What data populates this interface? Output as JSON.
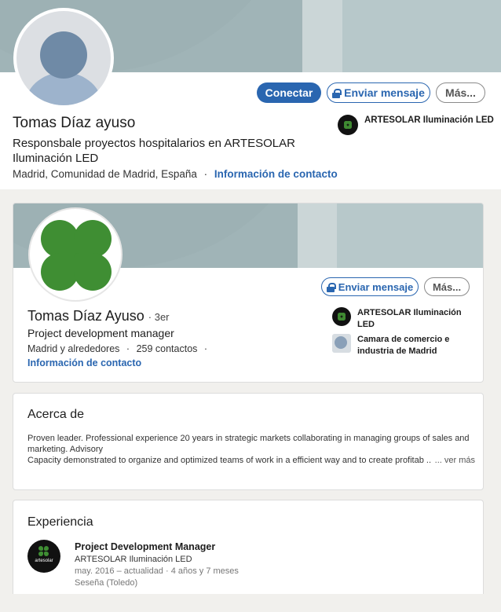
{
  "top_profile": {
    "name": "Tomas Díaz ayuso",
    "headline": "Responsbale proyectos hospitalarios en ARTESOLAR Iluminación LED",
    "location": "Madrid, Comunidad de Madrid, España",
    "separator": "·",
    "contact_link": "Información de contacto",
    "buttons": {
      "connect": "Conectar",
      "message": "Enviar mensaje",
      "more": "Más..."
    },
    "company": "ARTESOLAR Iluminación LED"
  },
  "company_profile": {
    "name": "Tomas Díaz Ayuso",
    "degree": "3er",
    "headline": "Project development manager",
    "location": "Madrid y alrededores",
    "contacts": "259 contactos",
    "contact_link": "Información de contacto",
    "buttons": {
      "message": "Enviar mensaje",
      "more": "Más..."
    },
    "companies": [
      {
        "name": "ARTESOLAR Iluminación LED"
      },
      {
        "name": "Camara de comercio e industria de Madrid"
      }
    ]
  },
  "about": {
    "title": "Acerca de",
    "line1": "Proven leader. Professional experience 20 years in strategic markets collaborating in managing groups of sales and marketing. Advisory",
    "line2": "Capacity demonstrated to organize and optimized teams of work in a efficient way and to create profitab ...",
    "see_more": "... ver más"
  },
  "experience": {
    "title": "Experiencia",
    "items": [
      {
        "role": "Project Development Manager",
        "company": "ARTESOLAR Iluminación LED",
        "dates": "may. 2016 – actualidad · 4 años y 7 meses",
        "location": "Seseña (Toledo)",
        "logo_text": "artesolar"
      }
    ]
  },
  "colors": {
    "accent": "#2a66b0",
    "clover_green": "#3f8e33",
    "banner": "#a0b4b7"
  }
}
